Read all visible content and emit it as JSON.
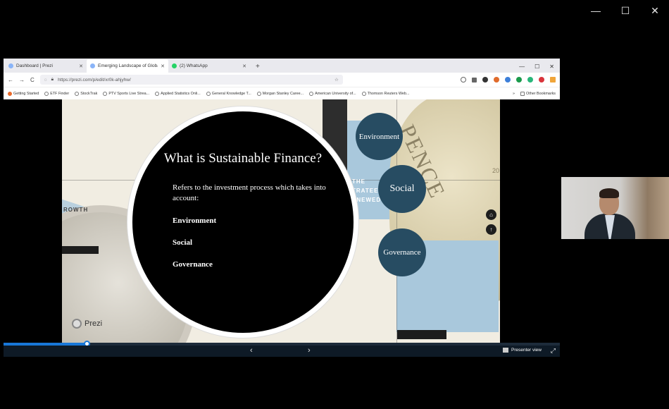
{
  "window": {
    "minimize": "—",
    "maximize": "☐",
    "close": "✕"
  },
  "browser": {
    "tabs": [
      {
        "title": "Dashboard | Prezi",
        "close": "✕"
      },
      {
        "title": "Emerging Landscape of Globa",
        "close": "✕"
      },
      {
        "title": "(2) WhatsApp",
        "close": "✕"
      }
    ],
    "new_tab": "+",
    "url": "https://prezi.com/p/edit/xr0k-ahjyhw/",
    "back": "←",
    "forward": "→",
    "reload": "C",
    "star": "☆",
    "bookmarks": [
      "Getting Started",
      "ETF Finder",
      "StockTrak",
      "PTV Sports Live Strea...",
      "Applied Statistics Onli...",
      "General Knowledge T...",
      "Morgan Stanley Caree...",
      "American University of...",
      "Thomson Reuters Web..."
    ],
    "bookmarks_more": "»",
    "other_bookmarks": "Other Bookmarks"
  },
  "slide": {
    "title": "What is Sustainable Finance?",
    "body": "Refers to the investment process which takes into account:",
    "items": [
      "Environment",
      "Social",
      "Governance"
    ],
    "nodes": [
      "Environment",
      "Social",
      "Governance"
    ],
    "bg_text_growth": "ROWTH",
    "bg_text_strat": [
      "THE",
      "TRATEE",
      "ENEWED"
    ],
    "bg_text_pence": "PENCE",
    "bg_text_year": "20",
    "home_icon": "⌂",
    "back_icon": "↑"
  },
  "prezi_badge": "Prezi",
  "presenter_bar": {
    "progress": 0.15,
    "prev": "‹",
    "next": "›",
    "presenter_view": "Presenter view",
    "fullscreen": "⤢"
  },
  "colors": {
    "node": "#274c62",
    "progress": "#1877d8"
  }
}
